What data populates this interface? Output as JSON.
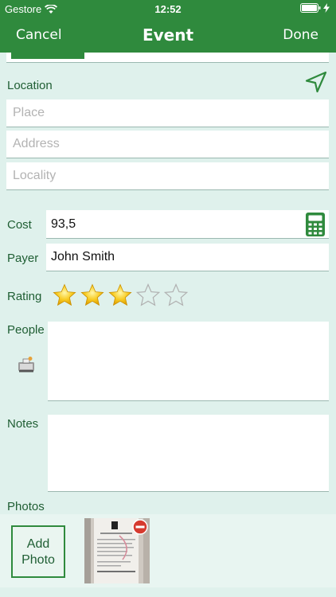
{
  "status": {
    "carrier": "Gestore",
    "time": "12:52"
  },
  "nav": {
    "cancel": "Cancel",
    "title": "Event",
    "done": "Done"
  },
  "location": {
    "label": "Location",
    "place_placeholder": "Place",
    "address_placeholder": "Address",
    "locality_placeholder": "Locality"
  },
  "cost": {
    "label": "Cost",
    "value": "93,5"
  },
  "payer": {
    "label": "Payer",
    "value": "John Smith"
  },
  "rating": {
    "label": "Rating",
    "value": 3,
    "max": 5
  },
  "people": {
    "label": "People"
  },
  "notes": {
    "label": "Notes"
  },
  "photos": {
    "label": "Photos",
    "add_line1": "Add",
    "add_line2": "Photo"
  },
  "colors": {
    "brand": "#2f8a3d",
    "background": "#dff1ec",
    "label": "#1f5e33"
  }
}
